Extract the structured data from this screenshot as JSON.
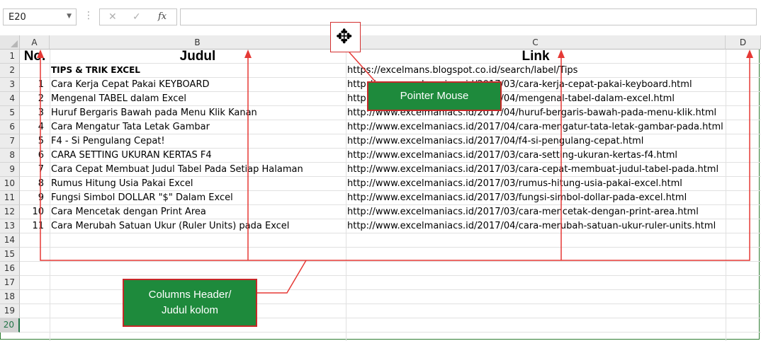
{
  "formula_bar": {
    "name_box": "E20",
    "cancel_icon": "✕",
    "enter_icon": "✓",
    "fx_label": "fx",
    "formula_value": ""
  },
  "columns": [
    {
      "key": "A",
      "label": "A"
    },
    {
      "key": "B",
      "label": "B"
    },
    {
      "key": "C",
      "label": "C"
    },
    {
      "key": "D",
      "label": "D"
    }
  ],
  "rows": [
    {
      "row": "1",
      "a": "No.",
      "b": "Judul",
      "c": "Link",
      "header": true
    },
    {
      "row": "2",
      "a": "",
      "b": "TIPS & TRIK EXCEL",
      "c": "https://excelmans.blogspot.co.id/search/label/Tips",
      "bold_b": true
    },
    {
      "row": "3",
      "a": "1",
      "b": "Cara Kerja Cepat Pakai KEYBOARD",
      "c": "http://www.excelmaniacs.id/2017/03/cara-kerja-cepat-pakai-keyboard.html"
    },
    {
      "row": "4",
      "a": "2",
      "b": "Mengenal TABEL dalam Excel",
      "c": "http://www.excelmaniacs.id/2017/04/mengenal-tabel-dalam-excel.html"
    },
    {
      "row": "5",
      "a": "3",
      "b": "Huruf Bergaris Bawah pada Menu Klik Kanan",
      "c": "http://www.excelmaniacs.id/2017/04/huruf-bergaris-bawah-pada-menu-klik.html"
    },
    {
      "row": "6",
      "a": "4",
      "b": "Cara Mengatur Tata Letak Gambar",
      "c": "http://www.excelmaniacs.id/2017/04/cara-mengatur-tata-letak-gambar-pada.html"
    },
    {
      "row": "7",
      "a": "5",
      "b": "F4 - Si Pengulang Cepat!",
      "c": "http://www.excelmaniacs.id/2017/04/f4-si-pengulang-cepat.html"
    },
    {
      "row": "8",
      "a": "6",
      "b": "CARA SETTING UKURAN KERTAS F4",
      "c": "http://www.excelmaniacs.id/2017/03/cara-setting-ukuran-kertas-f4.html"
    },
    {
      "row": "9",
      "a": "7",
      "b": "Cara Cepat Membuat Judul Tabel Pada Setiap Halaman",
      "c": "http://www.excelmaniacs.id/2017/03/cara-cepat-membuat-judul-tabel-pada.html"
    },
    {
      "row": "10",
      "a": "8",
      "b": "Rumus Hitung Usia Pakai Excel",
      "c": "http://www.excelmaniacs.id/2017/03/rumus-hitung-usia-pakai-excel.html"
    },
    {
      "row": "11",
      "a": "9",
      "b": "Fungsi Simbol DOLLAR \"$\" Dalam Excel",
      "c": "http://www.excelmaniacs.id/2017/03/fungsi-simbol-dollar-pada-excel.html"
    },
    {
      "row": "12",
      "a": "10",
      "b": "Cara Mencetak dengan Print Area",
      "c": "http://www.excelmaniacs.id/2017/03/cara-mencetak-dengan-print-area.html"
    },
    {
      "row": "13",
      "a": "11",
      "b": "Cara Merubah Satuan Ukur (Ruler Units) pada Excel",
      "c": "http://www.excelmaniacs.id/2017/04/cara-merubah-satuan-ukur-ruler-units.html"
    },
    {
      "row": "14",
      "a": "",
      "b": "",
      "c": ""
    },
    {
      "row": "15",
      "a": "",
      "b": "",
      "c": ""
    },
    {
      "row": "16",
      "a": "",
      "b": "",
      "c": ""
    },
    {
      "row": "17",
      "a": "",
      "b": "",
      "c": ""
    },
    {
      "row": "18",
      "a": "",
      "b": "",
      "c": ""
    },
    {
      "row": "19",
      "a": "",
      "b": "",
      "c": ""
    },
    {
      "row": "20",
      "a": "",
      "b": "",
      "c": "",
      "active": true
    }
  ],
  "annotations": {
    "pointer_label": "Pointer Mouse",
    "column_header_line1": "Columns Header/",
    "column_header_line2": "Judul kolom",
    "cursor_glyph": "✥"
  },
  "colors": {
    "callout_fill": "#1e8a3c",
    "callout_border": "#c62828",
    "annotation_line": "#e53935",
    "excel_green": "#217346"
  }
}
